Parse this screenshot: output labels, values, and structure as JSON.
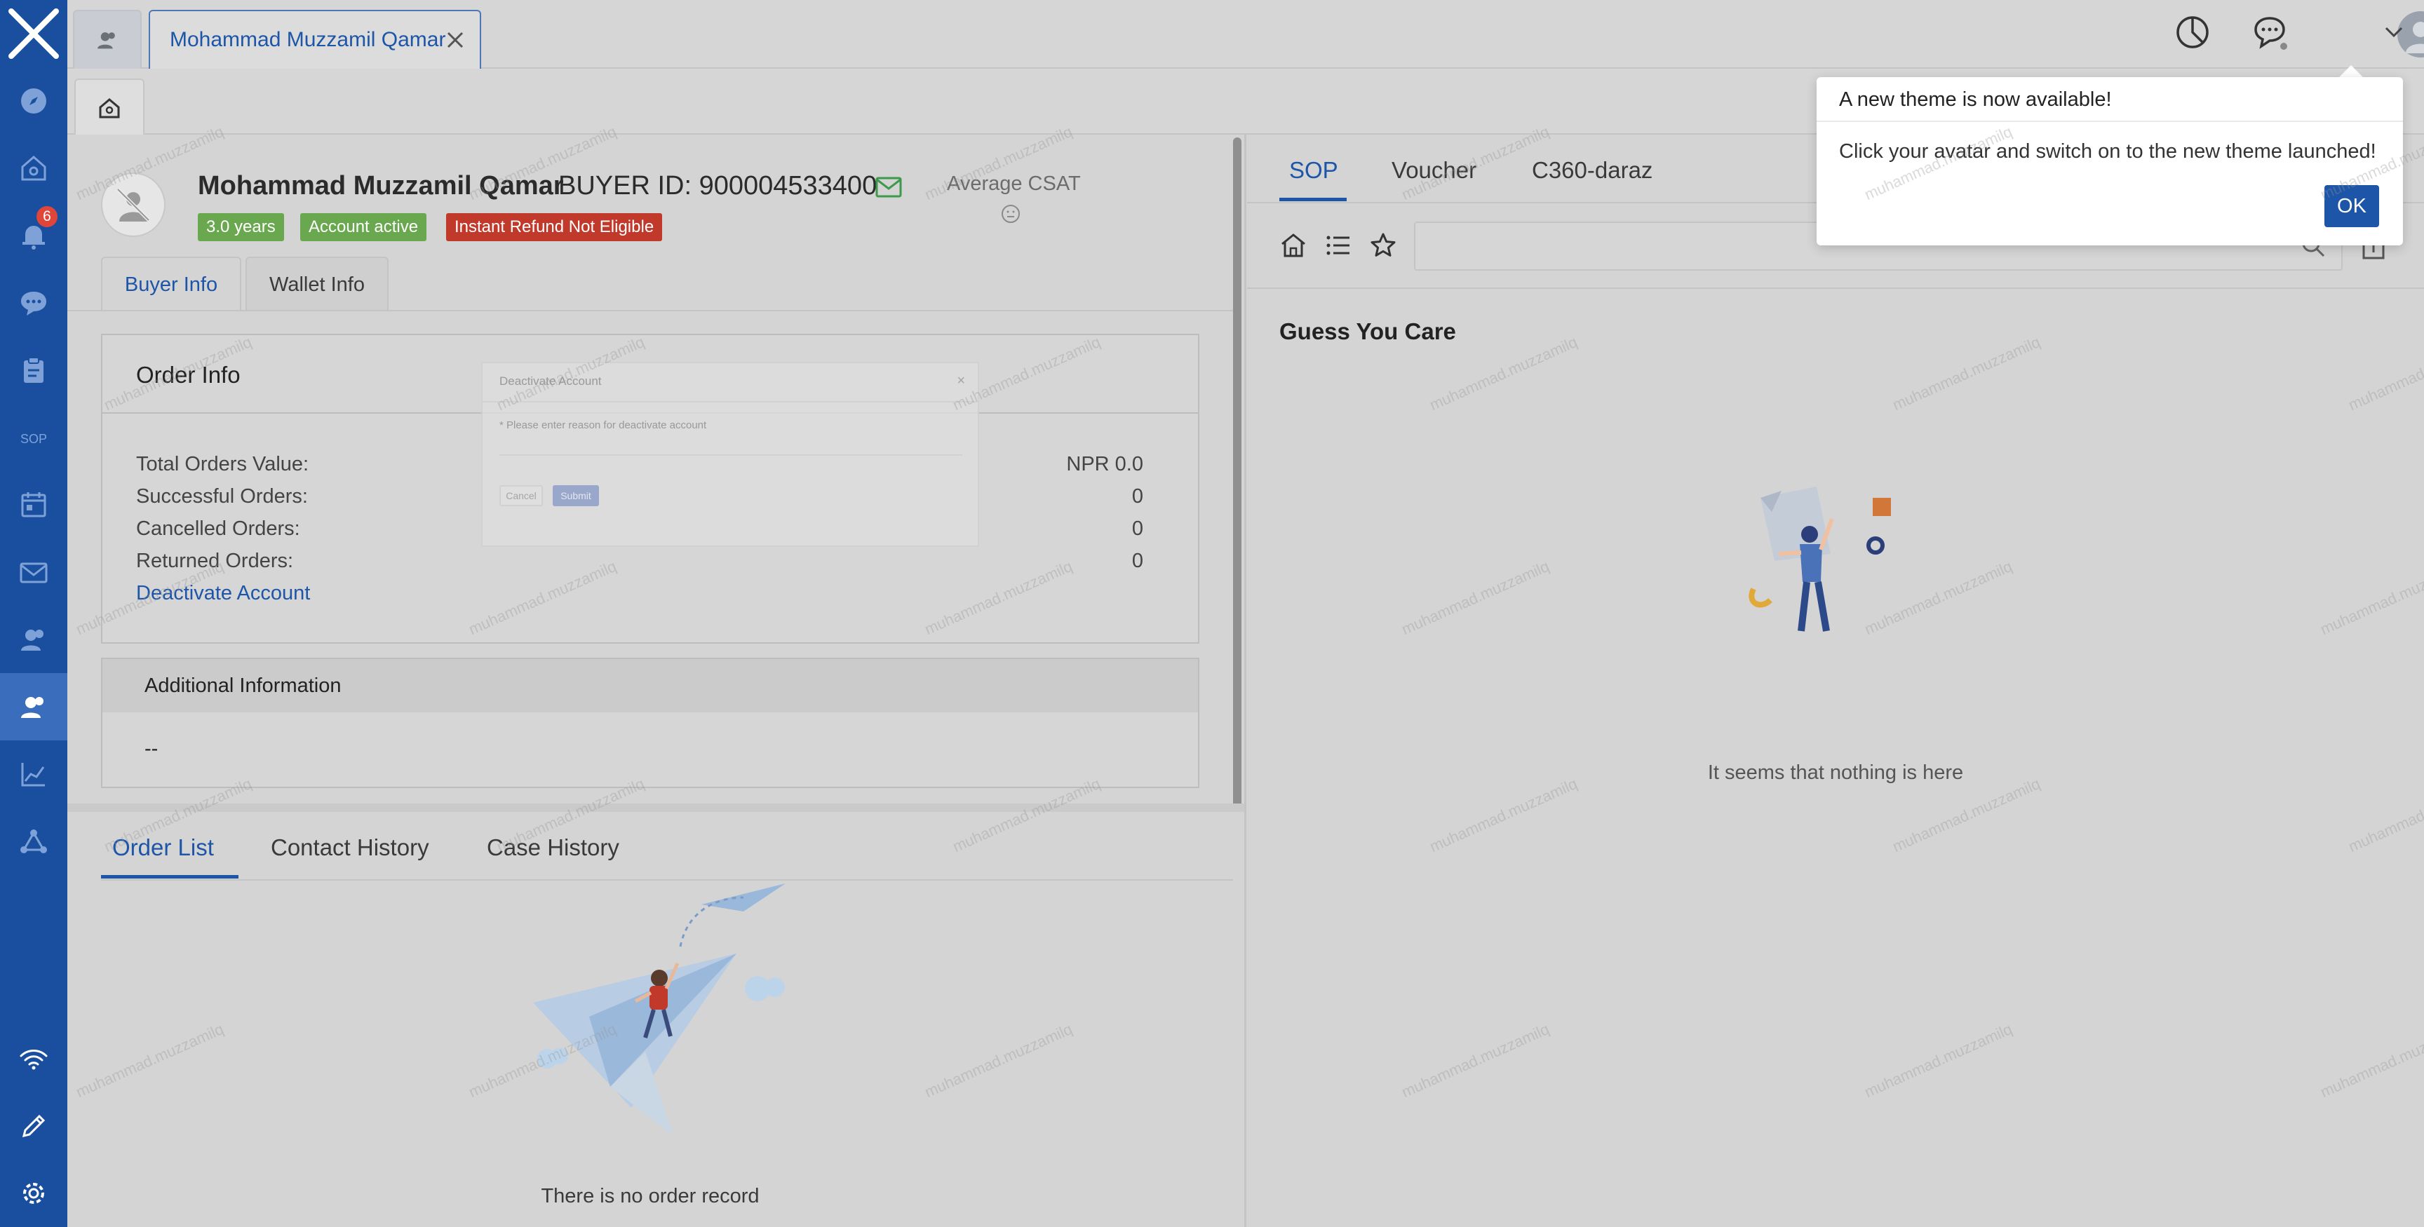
{
  "nav": {
    "notification_count": "6",
    "items": [
      "compass",
      "home",
      "notifications",
      "chat",
      "clipboard",
      "sop",
      "calendar",
      "mail",
      "contacts",
      "customer",
      "analytics",
      "network",
      "wifi",
      "edit",
      "settings"
    ]
  },
  "tabs": {
    "customer_tab_label": "Mohammad Muzzamil Qamar"
  },
  "profile": {
    "name": "Mohammad Muzzamil Qamar",
    "buyer_id": "BUYER ID: 900004533400",
    "tags": [
      "3.0 years",
      "Account active",
      "Instant Refund Not Eligible"
    ],
    "csat_label": "Average CSAT"
  },
  "profile_tabs": [
    "Buyer Info",
    "Wallet Info"
  ],
  "order_info": {
    "title": "Order Info",
    "rows": [
      {
        "label": "Total Orders Value:",
        "value": "NPR 0.0"
      },
      {
        "label": "Successful Orders:",
        "value": "0"
      },
      {
        "label": "Cancelled Orders:",
        "value": "0"
      },
      {
        "label": "Returned Orders:",
        "value": "0"
      }
    ],
    "deactivate_link": "Deactivate Account"
  },
  "additional_info": {
    "title": "Additional Information",
    "value": "--"
  },
  "modal": {
    "title": "Deactivate Account",
    "label": "* Please enter reason for deactivate account",
    "cancel": "Cancel",
    "submit": "Submit"
  },
  "bottom_tabs": [
    "Order List",
    "Contact History",
    "Case History"
  ],
  "order_empty": "There is no order record",
  "right_tabs": [
    "SOP",
    "Voucher",
    "C360-daraz"
  ],
  "guess": {
    "title": "Guess You Care",
    "empty": "It seems that nothing is here"
  },
  "popover": {
    "title": "A new theme is now available!",
    "body": "Click your avatar and switch on to the new theme launched!",
    "ok": "OK"
  },
  "watermark": "muhammad.muzzamilq",
  "colors": {
    "nav_bg": "#1a4fa0",
    "accent": "#1d55a8",
    "tag_green": "#6aa84f",
    "tag_red": "#c0392b",
    "badge_red": "#e0453a"
  }
}
